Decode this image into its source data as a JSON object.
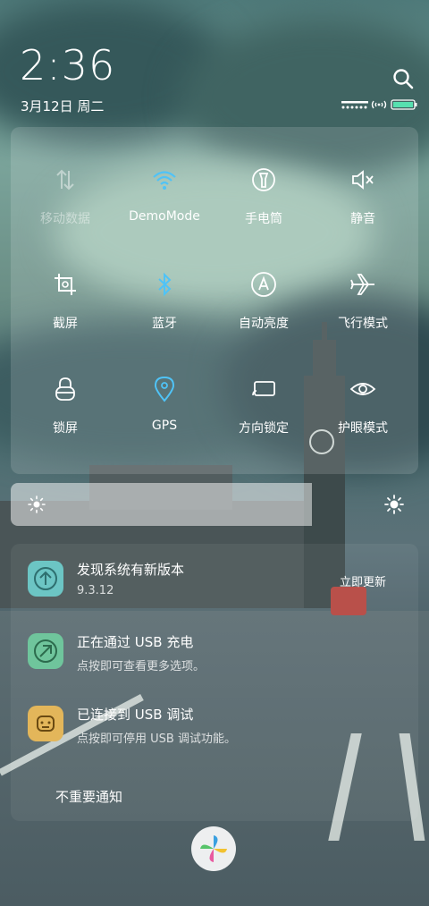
{
  "status": {
    "time": "2:36",
    "date": "3月12日 周二"
  },
  "quick_settings": [
    {
      "label": "移动数据",
      "icon": "mobile-data-icon",
      "state": "disabled"
    },
    {
      "label": "DemoMode",
      "icon": "wifi-icon",
      "state": "active"
    },
    {
      "label": "手电筒",
      "icon": "flashlight-icon",
      "state": "off"
    },
    {
      "label": "静音",
      "icon": "mute-icon",
      "state": "off"
    },
    {
      "label": "截屏",
      "icon": "screenshot-icon",
      "state": "off"
    },
    {
      "label": "蓝牙",
      "icon": "bluetooth-icon",
      "state": "active"
    },
    {
      "label": "自动亮度",
      "icon": "auto-brightness-icon",
      "state": "off"
    },
    {
      "label": "飞行模式",
      "icon": "airplane-icon",
      "state": "off"
    },
    {
      "label": "锁屏",
      "icon": "lock-icon",
      "state": "off"
    },
    {
      "label": "GPS",
      "icon": "gps-icon",
      "state": "active"
    },
    {
      "label": "方向锁定",
      "icon": "rotation-lock-icon",
      "state": "off"
    },
    {
      "label": "护眼模式",
      "icon": "eye-icon",
      "state": "off"
    }
  ],
  "brightness": {
    "level": 0.74
  },
  "notifications": [
    {
      "title": "发现系统有新版本",
      "subtitle": "9.3.12",
      "action": "立即更新",
      "icon": "update-icon"
    },
    {
      "title": "正在通过 USB 充电",
      "subtitle": "点按即可查看更多选项。",
      "icon": "usb-charge-icon"
    },
    {
      "title": "已连接到 USB 调试",
      "subtitle": "点按即可停用 USB 调试功能。",
      "icon": "android-debug-icon"
    }
  ],
  "unimportant_label": "不重要通知",
  "colors": {
    "accent": "#4fc3f7",
    "update_icon": "#6cc5c4",
    "charge_icon": "#6fc59c",
    "debug_icon": "#e3b65a"
  }
}
